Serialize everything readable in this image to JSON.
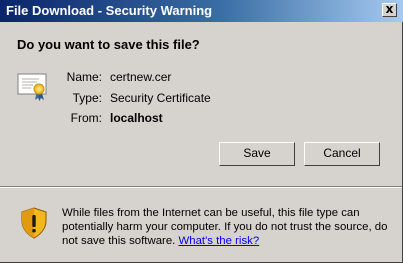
{
  "window": {
    "title": "File Download - Security Warning",
    "close_glyph": "x"
  },
  "dialog": {
    "question": "Do you want to save this file?",
    "icon": "certificate-icon",
    "fields": [
      {
        "label": "Name:",
        "value": "certnew.cer"
      },
      {
        "label": "Type:",
        "value": "Security Certificate"
      },
      {
        "label": "From:",
        "value": "localhost"
      }
    ]
  },
  "buttons": {
    "save_label": "Save",
    "cancel_label": "Cancel"
  },
  "warning": {
    "icon": "shield-warning-icon",
    "text": "While files from the Internet can be useful, this file type can potentially harm your computer. If you do not trust the source, do not save this software. ",
    "link_text": "What's the risk?"
  },
  "colors": {
    "titlebar_start": "#0a246a",
    "titlebar_end": "#a6caf0",
    "dialog_bg": "#d6d3ce",
    "link": "#0000ee"
  }
}
